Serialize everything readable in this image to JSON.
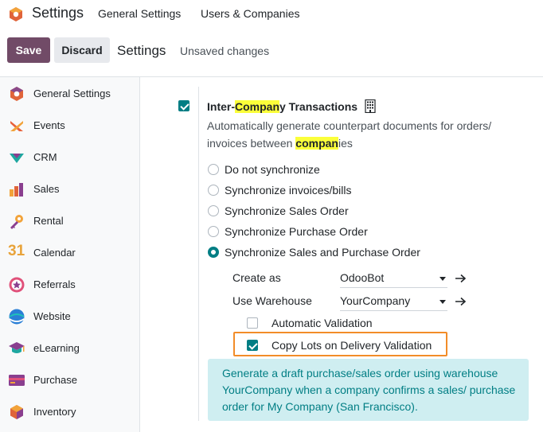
{
  "app": {
    "title": "Settings"
  },
  "nav": {
    "general": "General Settings",
    "users": "Users & Companies"
  },
  "control_panel": {
    "save": "Save",
    "discard": "Discard",
    "title": "Settings",
    "status": "Unsaved changes"
  },
  "sidebar": {
    "items": [
      {
        "label": "General Settings",
        "icon": "odoo-logo-icon"
      },
      {
        "label": "Events",
        "icon": "events-icon"
      },
      {
        "label": "CRM",
        "icon": "crm-icon"
      },
      {
        "label": "Sales",
        "icon": "sales-icon"
      },
      {
        "label": "Rental",
        "icon": "rental-icon"
      },
      {
        "label": "Calendar",
        "icon": "calendar-icon",
        "icon_text": "31"
      },
      {
        "label": "Referrals",
        "icon": "referrals-icon"
      },
      {
        "label": "Website",
        "icon": "website-icon"
      },
      {
        "label": "eLearning",
        "icon": "elearning-icon"
      },
      {
        "label": "Purchase",
        "icon": "purchase-icon"
      },
      {
        "label": "Inventory",
        "icon": "inventory-icon"
      }
    ]
  },
  "feature": {
    "checked": true,
    "title_pre": "Inter-",
    "title_hl": "Compan",
    "title_post": "y Transactions",
    "desc_line1": "Automatically generate counterpart documents for orders/",
    "desc_line2_pre": "invoices between ",
    "desc_line2_hl": "compan",
    "desc_line2_post": "ies",
    "options": [
      "Do not synchronize",
      "Synchronize invoices/bills",
      "Synchronize Sales Order",
      "Synchronize Purchase Order",
      "Synchronize Sales and Purchase Order"
    ],
    "selected_option": 4,
    "create_as": {
      "label": "Create as",
      "value": "OdooBot"
    },
    "use_warehouse": {
      "label": "Use Warehouse",
      "value": "YourCompany"
    },
    "automatic_validation": {
      "label": "Automatic Validation",
      "checked": false
    },
    "copy_lots": {
      "label": "Copy Lots on Delivery Validation",
      "checked": true
    },
    "info": "Generate a draft purchase/sales order using warehouse YourCompany when a company confirms a sales/ purchase order for My Company (San Francisco)."
  },
  "colors": {
    "brand": "#714b67",
    "accent": "#017e84",
    "highlight": "#fbff3a",
    "focus_box": "#f28c28",
    "info_bg": "#cfeef1"
  }
}
